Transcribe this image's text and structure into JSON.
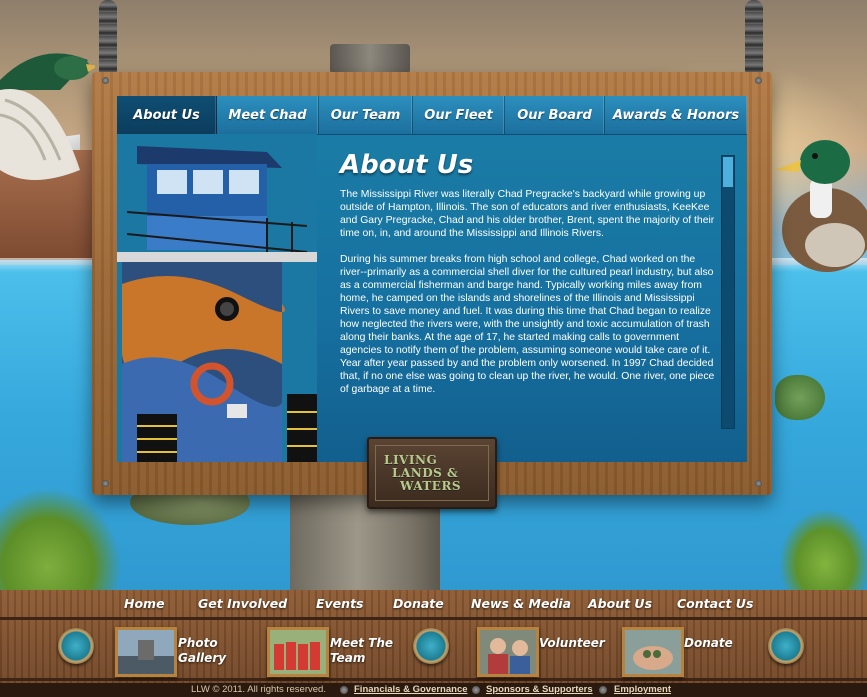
{
  "top_nav": {
    "items": [
      {
        "label": "About Us",
        "active": true
      },
      {
        "label": "Meet Chad",
        "active": false
      },
      {
        "label": "Our Team",
        "active": false
      },
      {
        "label": "Our Fleet",
        "active": false
      },
      {
        "label": "Our Board",
        "active": false
      },
      {
        "label": "Awards & Honors",
        "active": false
      }
    ]
  },
  "main": {
    "title": "About Us",
    "paragraphs": [
      "The Mississippi River was literally Chad Pregracke's backyard while growing up outside of Hampton, Illinois. The son of educators and river enthusiasts, KeeKee and Gary Pregracke, Chad and his older brother, Brent, spent the majority of their time on, in, and around the Mississippi and Illinois Rivers.",
      "During his summer breaks from high school and college, Chad worked on the river--primarily as a commercial shell diver for the cultured pearl industry, but also as a commercial fisherman and barge hand. Typically working miles away from home, he camped on the islands and shorelines of the Illinois and Mississippi Rivers to save money and fuel. It was during this time that Chad began to realize how neglected the rivers were, with the unsightly and toxic accumulation of trash along their banks. At the age of 17, he started making calls to government agencies to notify them of the problem, assuming someone would take care of it. Year after year passed by and the problem only worsened. In 1997 Chad decided that, if no one else was going to clean up the river, he would. One river, one piece of garbage at a time."
    ]
  },
  "logo": {
    "line1": "LIVING",
    "line2": "LANDS &",
    "line3": "WATERS"
  },
  "bottom_nav": {
    "items": [
      "Home",
      "Get Involved",
      "Events",
      "Donate",
      "News & Media",
      "About Us",
      "Contact Us"
    ]
  },
  "quick_links": [
    {
      "label_line1": "Photo",
      "label_line2": "Gallery"
    },
    {
      "label_line1": "Meet The",
      "label_line2": "Team"
    },
    {
      "label_line1": "Volunteer",
      "label_line2": ""
    },
    {
      "label_line1": "Donate",
      "label_line2": ""
    }
  ],
  "footer": {
    "copyright": "LLW © 2011. All rights reserved.",
    "links": [
      "Financials & Governance",
      "Sponsors & Supporters",
      "Employment"
    ]
  },
  "colors": {
    "panel_blue": "#1670a0",
    "tab_blue": "#2c8fbe",
    "active_tab": "#0f4e73",
    "wood": "#9a6634"
  }
}
